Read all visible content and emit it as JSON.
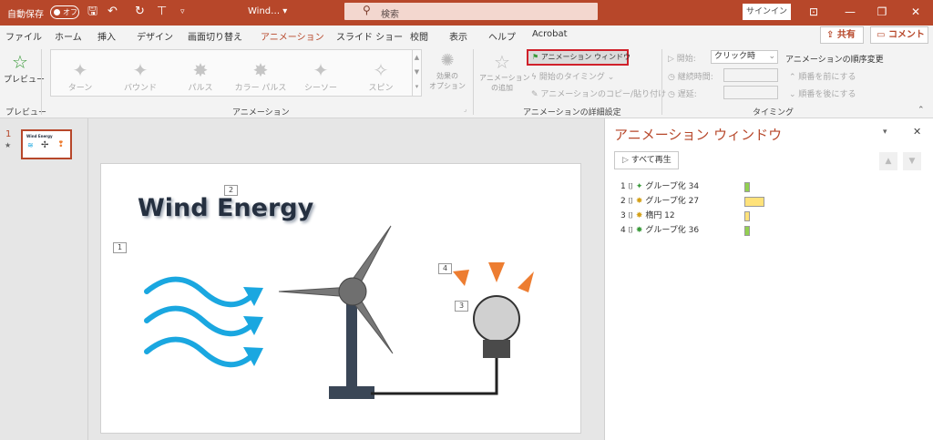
{
  "titlebar": {
    "autosave": "自動保存",
    "toggle": "オフ",
    "filename": "Wind… ▾",
    "search_placeholder": "検索",
    "signin": "サインイン"
  },
  "tabs": [
    "ファイル",
    "ホーム",
    "挿入",
    "デザイン",
    "画面切り替え",
    "アニメーション",
    "スライド ショー",
    "校閲",
    "表示",
    "ヘルプ",
    "Acrobat"
  ],
  "active_tab": "アニメーション",
  "share": "共有",
  "comment": "コメント",
  "ribbon": {
    "preview": "プレビュー",
    "group_preview": "プレビュー",
    "effects": [
      "ターン",
      "バウンド",
      "パルス",
      "カラー パルス",
      "シーソー",
      "スピン"
    ],
    "effect_options": "効果の\nオプション",
    "group_animation": "アニメーション",
    "add_animation": "アニメーション\nの追加",
    "anim_pane_btn": "アニメーション ウィンドウ",
    "trigger": "開始のタイミング",
    "painter": "アニメーションのコピー/貼り付け",
    "group_advanced": "アニメーションの詳細設定",
    "start_label": "開始:",
    "start_value": "クリック時",
    "duration_label": "継続時間:",
    "delay_label": "遅延:",
    "reorder_title": "アニメーションの順序変更",
    "move_earlier": "順番を前にする",
    "move_later": "順番を後にする",
    "group_timing": "タイミング"
  },
  "thumb": {
    "number": "1",
    "title": "Wind Energy"
  },
  "slide": {
    "title": "Wind Energy",
    "markers": [
      "2",
      "1",
      "4",
      "3"
    ]
  },
  "pane": {
    "title": "アニメーション ウィンドウ",
    "play_all": "すべて再生",
    "items": [
      {
        "num": "1",
        "name": "グループ化 34",
        "color": "#92d050"
      },
      {
        "num": "2",
        "name": "グループ化 27",
        "color": "#ffe27a"
      },
      {
        "num": "3",
        "name": "楕円 12",
        "color": "#ffe27a"
      },
      {
        "num": "4",
        "name": "グループ化 36",
        "color": "#92d050"
      }
    ]
  },
  "colors": {
    "accent": "#b7472a",
    "arrow_blue": "#1aa7e0",
    "burst": "#ed7d31"
  }
}
